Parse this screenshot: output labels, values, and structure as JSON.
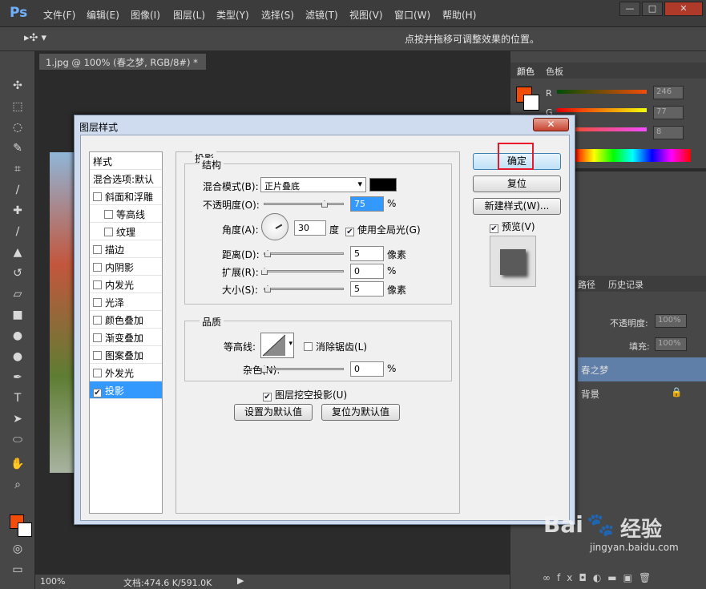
{
  "app": {
    "logo": "Ps",
    "menu": [
      "文件(F)",
      "编辑(E)",
      "图像(I)",
      "图层(L)",
      "类型(Y)",
      "选择(S)",
      "滤镜(T)",
      "视图(V)",
      "窗口(W)",
      "帮助(H)"
    ]
  },
  "options": {
    "hint": "点按并拖移可调整效果的位置。"
  },
  "document": {
    "tab": "1.jpg @ 100% (春之梦, RGB/8#) *",
    "zoom": "100%",
    "docsize": "文档:474.6 K/591.0K"
  },
  "panels": {
    "color_tab": "颜色",
    "swatch_tab": "色板",
    "r_label": "R",
    "g_label": "G",
    "r_value": "246",
    "g_value": "77",
    "b_value": "8",
    "paths_tab": "路径",
    "history_tab": "历史记录",
    "opacity_label": "不透明度:",
    "opacity_value": "100%",
    "fill_label": "填充:",
    "fill_value": "100%",
    "layer1": "春之梦",
    "layer2": "背景",
    "fg_color": "#f24d08"
  },
  "dialog": {
    "title": "图层样式",
    "close": "✕",
    "styles_header": "样式",
    "blend_options": "混合选项:默认",
    "styles": [
      {
        "label": "斜面和浮雕",
        "checked": false
      },
      {
        "label": "等高线",
        "checked": false
      },
      {
        "label": "纹理",
        "checked": false
      },
      {
        "label": "描边",
        "checked": false
      },
      {
        "label": "内阴影",
        "checked": false
      },
      {
        "label": "内发光",
        "checked": false
      },
      {
        "label": "光泽",
        "checked": false
      },
      {
        "label": "颜色叠加",
        "checked": false
      },
      {
        "label": "渐变叠加",
        "checked": false
      },
      {
        "label": "图案叠加",
        "checked": false
      },
      {
        "label": "外发光",
        "checked": false
      },
      {
        "label": "投影",
        "checked": true
      }
    ],
    "section_title": "投影",
    "structure_title": "结构",
    "blend_mode_label": "混合模式(B):",
    "blend_mode_value": "正片叠底",
    "opacity_label": "不透明度(O):",
    "opacity_value": "75",
    "opacity_pct": 75,
    "angle_label": "角度(A):",
    "angle_value": "30",
    "angle_unit": "度",
    "global_light_label": "使用全局光(G)",
    "distance_label": "距离(D):",
    "distance_value": "5",
    "spread_label": "扩展(R):",
    "spread_value": "0",
    "size_label": "大小(S):",
    "size_value": "5",
    "px_unit": "像素",
    "pct_unit": "%",
    "quality_title": "品质",
    "contour_label": "等高线:",
    "antialias_label": "消除锯齿(L)",
    "noise_label": "杂色(N):",
    "noise_value": "0",
    "knockout_label": "图层挖空投影(U)",
    "make_default": "设置为默认值",
    "reset_default": "复位为默认值",
    "ok": "确定",
    "reset": "复位",
    "new_style": "新建样式(W)...",
    "preview_label": "预览(V)"
  },
  "watermark": {
    "brand": "Bai",
    "brand2": "经验",
    "url": "jingyan.baidu.com"
  }
}
